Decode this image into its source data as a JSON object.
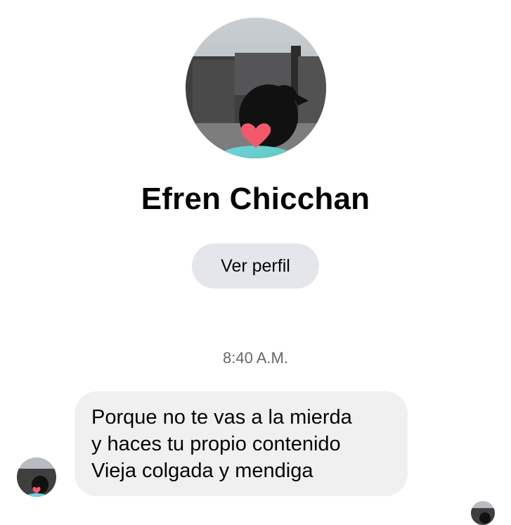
{
  "profile": {
    "name": "Efren Chicchan",
    "view_profile_label": "Ver perfil",
    "photo_icon": "dog-silhouette-with-heart-sticker"
  },
  "conversation": {
    "timestamp": "8:40 A.M.",
    "messages": [
      {
        "lines": [
          "Porque no te vas a la mierda",
          "y haces tu propio contenido",
          "Vieja colgada y mendiga"
        ]
      }
    ]
  },
  "colors": {
    "bubble_bg": "#f0f0f0",
    "button_bg": "#e4e6eb",
    "timestamp_text": "#65676b",
    "heart": "#f25a6b"
  }
}
